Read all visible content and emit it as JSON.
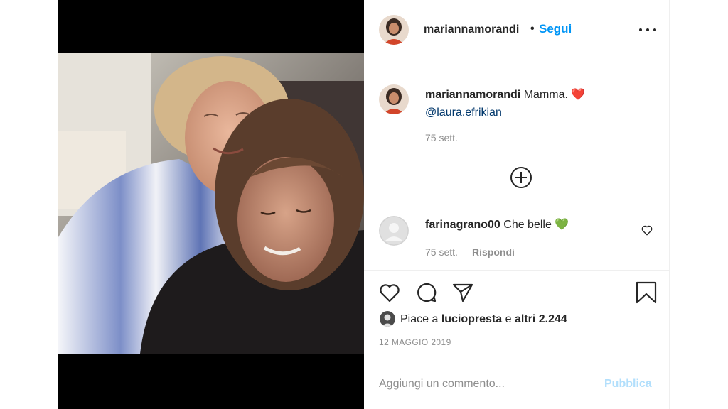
{
  "post": {
    "author": "mariannamorandi",
    "separator": "•",
    "follow_label": "Segui",
    "more_icon": "more-horizontal-icon",
    "photo": {
      "icon": "photo-of-two-women-embracing"
    }
  },
  "caption": {
    "user": "mariannamorandi",
    "text": " Mamma. ❤️",
    "mention": "@laura.efrikian",
    "time": "75 sett."
  },
  "load_more_icon": "plus-circle-icon",
  "comments": [
    {
      "user": "farinagrano00",
      "text": " Che belle 💚",
      "time": "75 sett.",
      "reply_label": "Rispondi",
      "like_icon": "heart-outline-icon"
    }
  ],
  "actions": {
    "like_icon": "heart-icon",
    "comment_icon": "comment-icon",
    "share_icon": "paper-plane-icon",
    "save_icon": "bookmark-icon"
  },
  "likes": {
    "prefix": "Piace a ",
    "user": "luciopresta",
    "middle": " e ",
    "others": "altri 2.244"
  },
  "date": "12 MAGGIO 2019",
  "add_comment": {
    "placeholder": "Aggiungi un commento...",
    "post_label": "Pubblica"
  },
  "colors": {
    "accent": "#0095f6",
    "mention": "#00376b",
    "muted": "#8e8e8e",
    "post_disabled": "#b2dffc",
    "divider": "#efefef"
  }
}
